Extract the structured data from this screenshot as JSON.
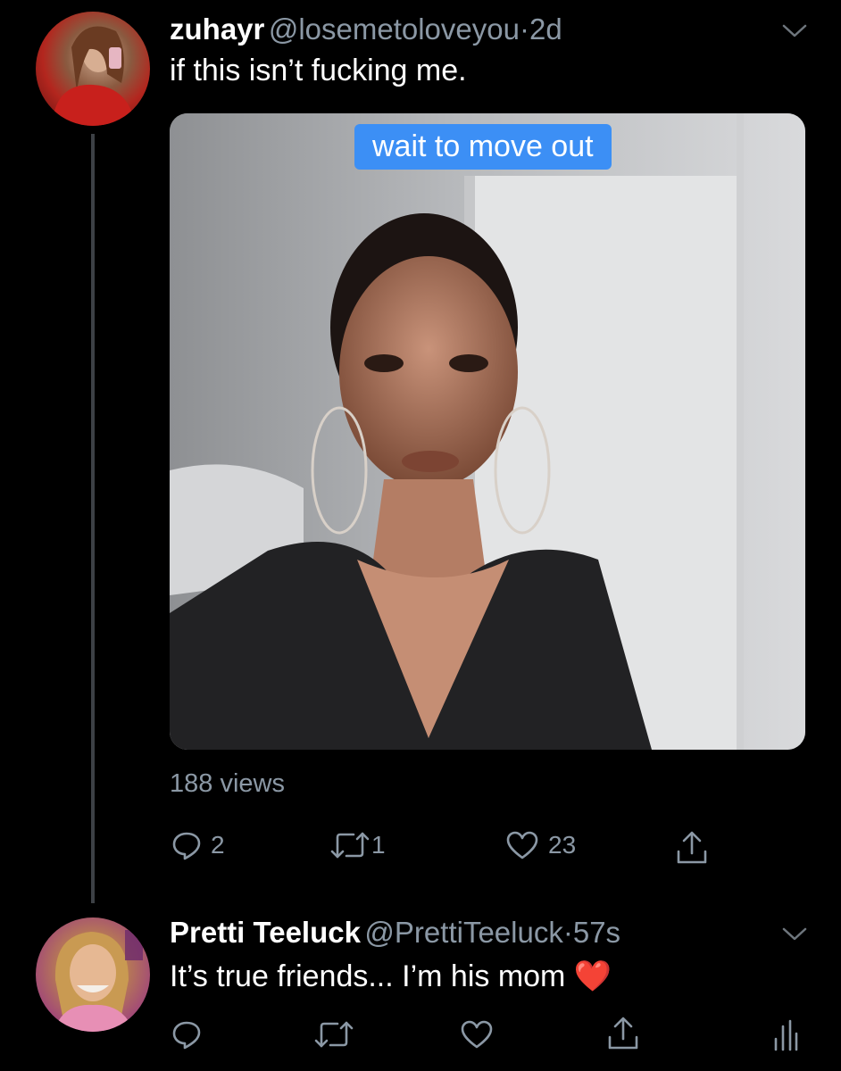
{
  "tweet1": {
    "display_name": "zuhayr",
    "handle": "@losemetoloveyou",
    "sep": "·",
    "time": "2d",
    "text": "if this isn’t fucking me.",
    "media_caption": "wait to move out",
    "views": "188 views",
    "replies": "2",
    "retweets": "1",
    "likes": "23"
  },
  "tweet2": {
    "display_name": "Pretti Teeluck",
    "handle": "@PrettiTeeluck",
    "sep": "·",
    "time": "57s",
    "text": "It’s true friends... I’m his mom",
    "emoji": "❤️"
  },
  "colors": {
    "background": "#000000",
    "muted": "#8b98a5",
    "caption_bg": "#3c8ff5",
    "thread_line": "#3d4146"
  }
}
